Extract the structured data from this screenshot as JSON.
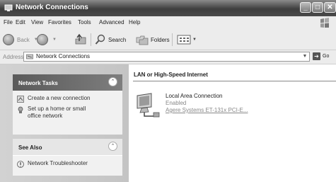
{
  "window": {
    "title": "Network Connections"
  },
  "menu": {
    "items": [
      {
        "label": "File"
      },
      {
        "label": "Edit"
      },
      {
        "label": "View"
      },
      {
        "label": "Favorites"
      },
      {
        "label": "Tools"
      },
      {
        "label": "Advanced"
      },
      {
        "label": "Help"
      }
    ]
  },
  "toolbar": {
    "back_label": "Back",
    "search_label": "Search",
    "folders_label": "Folders"
  },
  "address": {
    "label": "Address",
    "value": "Network Connections",
    "go_label": "Go"
  },
  "network_tasks": {
    "title": "Network Tasks",
    "items": [
      {
        "label": "Create a new connection"
      },
      {
        "label": "Set up a home or small office network"
      }
    ]
  },
  "see_also": {
    "title": "See Also",
    "items": [
      {
        "label": "Network Troubleshooter"
      }
    ]
  },
  "content": {
    "group_title": "LAN or High-Speed Internet",
    "connection": {
      "name": "Local Area Connection",
      "status": "Enabled",
      "device": "Agere Systems ET-131x PCI-E..."
    }
  }
}
